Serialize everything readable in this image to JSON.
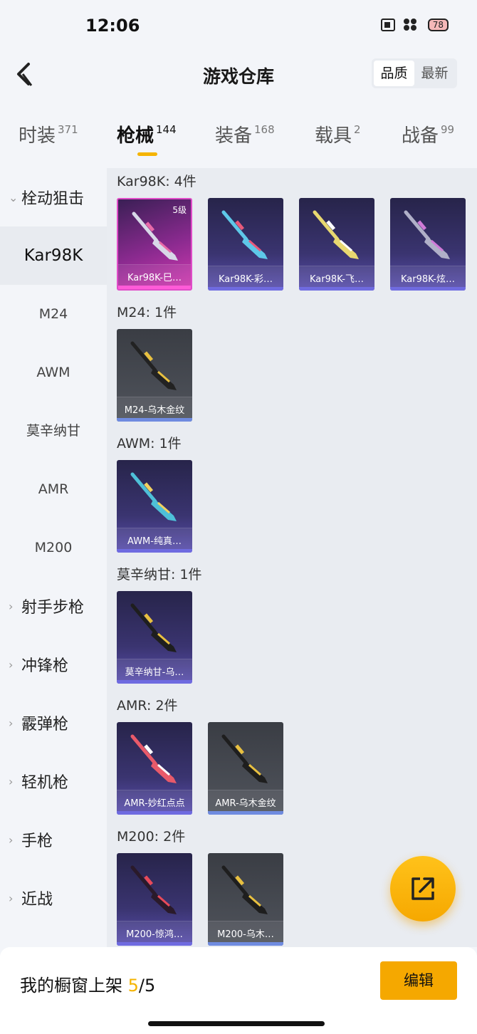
{
  "status": {
    "time": "12:06",
    "battery": "78"
  },
  "header": {
    "title": "游戏仓库",
    "sort_options": [
      "品质",
      "最新"
    ]
  },
  "tabs": [
    {
      "label": "时装",
      "count": "371"
    },
    {
      "label": "枪械",
      "count": "144"
    },
    {
      "label": "装备",
      "count": "168"
    },
    {
      "label": "载具",
      "count": "2"
    },
    {
      "label": "战备",
      "count": "99"
    }
  ],
  "sidebar": {
    "expanded_group": "栓动狙击",
    "sub_items": [
      "Kar98K",
      "M24",
      "AWM",
      "莫辛纳甘",
      "AMR",
      "M200"
    ],
    "groups": [
      "射手步枪",
      "冲锋枪",
      "霰弹枪",
      "轻机枪",
      "手枪",
      "近战"
    ]
  },
  "sections": [
    {
      "title": "Kar98K: 4件",
      "items": [
        {
          "name": "Kar98K-巳…",
          "level": "5级",
          "style": "pink",
          "gun_color": "#d8d8e8",
          "accent": "#e86aa8"
        },
        {
          "name": "Kar98K-彩…",
          "style": "purple",
          "gun_color": "#5ec8e8",
          "accent": "#e85a7a"
        },
        {
          "name": "Kar98K-飞…",
          "style": "purple",
          "gun_color": "#e8d870",
          "accent": "#ffffff"
        },
        {
          "name": "Kar98K-炫…",
          "style": "purple",
          "gun_color": "#b0b0c8",
          "accent": "#d07ad8"
        }
      ]
    },
    {
      "title": "M24: 1件",
      "items": [
        {
          "name": "M24-乌木金纹",
          "style": "gray",
          "gun_color": "#222222",
          "accent": "#e8c040"
        }
      ]
    },
    {
      "title": "AWM: 1件",
      "items": [
        {
          "name": "AWM-纯真…",
          "style": "purple",
          "gun_color": "#4ec0d8",
          "accent": "#f0d060"
        }
      ]
    },
    {
      "title": "莫辛纳甘: 1件",
      "items": [
        {
          "name": "莫辛纳甘-乌…",
          "style": "purple",
          "gun_color": "#1e1e1e",
          "accent": "#e8c040"
        }
      ]
    },
    {
      "title": "AMR: 2件",
      "items": [
        {
          "name": "AMR-妙红点点",
          "style": "purple",
          "gun_color": "#e85a6a",
          "accent": "#ffffff"
        },
        {
          "name": "AMR-乌木金纹",
          "style": "gray",
          "gun_color": "#1e1e1e",
          "accent": "#e8c040"
        }
      ]
    },
    {
      "title": "M200: 2件",
      "items": [
        {
          "name": "M200-惊鸿…",
          "style": "purple",
          "gun_color": "#2a1a2a",
          "accent": "#e84a5a"
        },
        {
          "name": "M200-乌木…",
          "style": "gray",
          "gun_color": "#1e1e1e",
          "accent": "#e8c040"
        }
      ]
    }
  ],
  "bottom": {
    "label": "我的橱窗上架",
    "current": "5",
    "total": "/5",
    "edit_label": "编辑"
  }
}
